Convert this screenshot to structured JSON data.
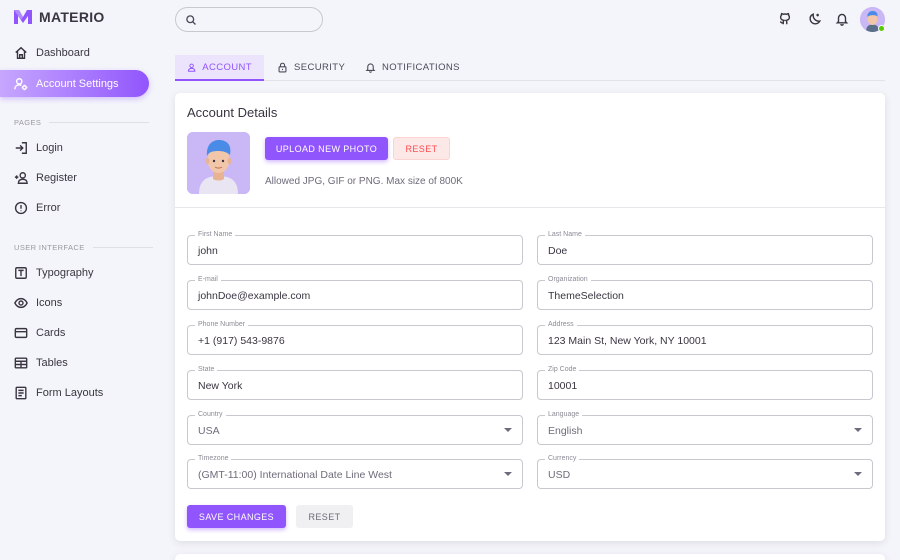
{
  "brand": {
    "name": "MATERIO"
  },
  "sidebar": {
    "items_top": [
      {
        "label": "Dashboard",
        "icon": "home-icon"
      },
      {
        "label": "Account Settings",
        "icon": "account-cog-icon",
        "active": true
      }
    ],
    "sections": [
      {
        "label": "PAGES",
        "items": [
          {
            "label": "Login",
            "icon": "login-icon"
          },
          {
            "label": "Register",
            "icon": "register-icon"
          },
          {
            "label": "Error",
            "icon": "alert-circle-icon"
          }
        ]
      },
      {
        "label": "USER INTERFACE",
        "items": [
          {
            "label": "Typography",
            "icon": "typography-icon"
          },
          {
            "label": "Icons",
            "icon": "eye-icon"
          },
          {
            "label": "Cards",
            "icon": "credit-card-icon"
          },
          {
            "label": "Tables",
            "icon": "table-icon"
          },
          {
            "label": "Form Layouts",
            "icon": "form-icon"
          }
        ]
      }
    ]
  },
  "search": {
    "placeholder": "",
    "value": ""
  },
  "tabs": [
    {
      "label": "ACCOUNT",
      "icon": "account-icon",
      "active": true
    },
    {
      "label": "SECURITY",
      "icon": "lock-icon"
    },
    {
      "label": "NOTIFICATIONS",
      "icon": "bell-icon"
    }
  ],
  "account": {
    "title": "Account Details",
    "upload_label": "UPLOAD NEW PHOTO",
    "reset_photo_label": "RESET",
    "hint": "Allowed JPG, GIF or PNG. Max size of 800K",
    "fields": [
      {
        "label": "First Name",
        "value": "john"
      },
      {
        "label": "Last Name",
        "value": "Doe"
      },
      {
        "label": "E-mail",
        "value": "johnDoe@example.com"
      },
      {
        "label": "Organization",
        "value": "ThemeSelection"
      },
      {
        "label": "Phone Number",
        "value": "+1 (917) 543-9876"
      },
      {
        "label": "Address",
        "value": "123 Main St, New York, NY 10001"
      },
      {
        "label": "State",
        "value": "New York"
      },
      {
        "label": "Zip Code",
        "value": "10001"
      },
      {
        "label": "Country",
        "value": "USA",
        "select": true
      },
      {
        "label": "Language",
        "value": "English",
        "select": true
      },
      {
        "label": "Timezone",
        "value": "(GMT-11:00) International Date Line West",
        "select": true
      },
      {
        "label": "Currency",
        "value": "USD",
        "select": true
      }
    ],
    "save_label": "SAVE CHANGES",
    "reset_label": "RESET"
  },
  "colors": {
    "primary": "#9155fd",
    "error": "#ff4c51",
    "online": "#56ca00"
  }
}
